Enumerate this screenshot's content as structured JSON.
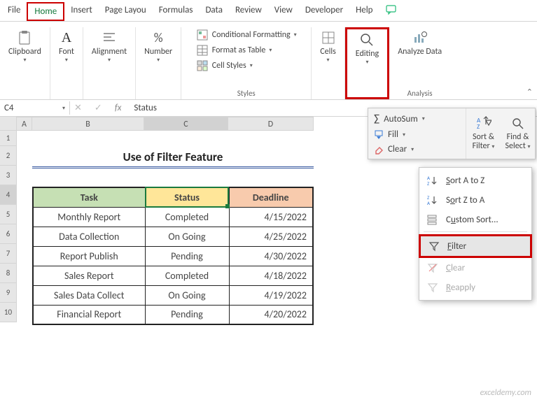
{
  "tabs": [
    "File",
    "Home",
    "Insert",
    "Page Layou",
    "Formulas",
    "Data",
    "Review",
    "View",
    "Developer",
    "Help"
  ],
  "ribbon": {
    "clipboard": "Clipboard",
    "font": "Font",
    "alignment": "Alignment",
    "number": "Number",
    "styles_lbl": "Styles",
    "cond_fmt": "Conditional Formatting",
    "fmt_table": "Format as Table",
    "cell_styles": "Cell Styles",
    "cells": "Cells",
    "editing": "Editing",
    "analyze": "Analyze Data",
    "analysis_lbl": "Analysis"
  },
  "namebox": "C4",
  "formula_val": "Status",
  "title": "Use of Filter Feature",
  "headers": {
    "task": "Task",
    "status": "Status",
    "deadline": "Deadline"
  },
  "rows": [
    {
      "task": "Monthly Report",
      "status": "Completed",
      "deadline": "4/15/2022"
    },
    {
      "task": "Data Collection",
      "status": "On Going",
      "deadline": "4/25/2022"
    },
    {
      "task": "Report Publish",
      "status": "Pending",
      "deadline": "4/30/2022"
    },
    {
      "task": "Sales Report",
      "status": "Completed",
      "deadline": "4/18/2022"
    },
    {
      "task": "Sales Data Collect",
      "status": "On Going",
      "deadline": "4/19/2022"
    },
    {
      "task": "Financial Report",
      "status": "Pending",
      "deadline": "4/20/2022"
    }
  ],
  "dd1": {
    "autosum": "AutoSum",
    "fill": "Fill",
    "clear": "Clear",
    "sortfilter": "Sort & Filter",
    "findselect": "Find & Select"
  },
  "dd2": {
    "sortaz": "Sort A to Z",
    "sortza": "Sort Z to A",
    "custom": "Custom Sort...",
    "filter": "Filter",
    "clear": "Clear",
    "reapply": "Reapply"
  },
  "dd2_keys": {
    "s": "S",
    "o": "o",
    "u": "u",
    "f": "F",
    "c": "C",
    "r": "R"
  },
  "cols": [
    "A",
    "B",
    "C",
    "D"
  ],
  "rownums": [
    "1",
    "2",
    "3",
    "4",
    "5",
    "6",
    "7",
    "8",
    "9",
    "10"
  ],
  "watermark": "exceldemy.com"
}
